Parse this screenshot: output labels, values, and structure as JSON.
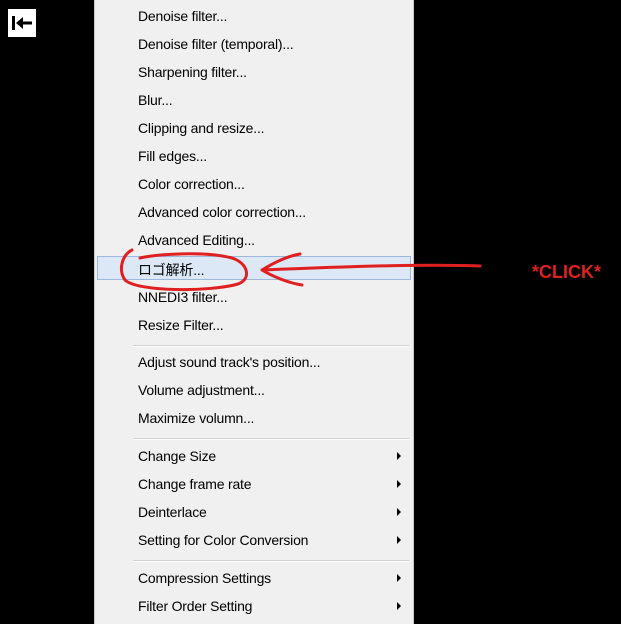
{
  "back_button": {
    "icon": "arrow-to-left-bar-icon"
  },
  "menu": {
    "groups": [
      {
        "items": [
          {
            "label": "Denoise filter...",
            "submenu": false
          },
          {
            "label": "Denoise filter (temporal)...",
            "submenu": false
          },
          {
            "label": "Sharpening filter...",
            "submenu": false
          },
          {
            "label": "Blur...",
            "submenu": false
          },
          {
            "label": "Clipping and resize...",
            "submenu": false
          },
          {
            "label": "Fill edges...",
            "submenu": false
          },
          {
            "label": "Color correction...",
            "submenu": false
          },
          {
            "label": "Advanced color correction...",
            "submenu": false
          },
          {
            "label": "Advanced Editing...",
            "submenu": false
          },
          {
            "label": "ロゴ解析...",
            "submenu": false,
            "highlighted": true
          },
          {
            "label": "NNEDI3 filter...",
            "submenu": false
          },
          {
            "label": "Resize Filter...",
            "submenu": false
          }
        ]
      },
      {
        "items": [
          {
            "label": "Adjust sound track's position...",
            "submenu": false
          },
          {
            "label": "Volume adjustment...",
            "submenu": false
          },
          {
            "label": "Maximize volumn...",
            "submenu": false
          }
        ]
      },
      {
        "items": [
          {
            "label": "Change Size",
            "submenu": true
          },
          {
            "label": "Change frame rate",
            "submenu": true
          },
          {
            "label": "Deinterlace",
            "submenu": true
          },
          {
            "label": "Setting for Color Conversion",
            "submenu": true
          }
        ]
      },
      {
        "items": [
          {
            "label": "Compression Settings",
            "submenu": true
          },
          {
            "label": "Filter Order Setting",
            "submenu": true
          }
        ]
      }
    ]
  },
  "annotation": {
    "text": "*CLICK*",
    "color": "#e02020"
  },
  "colors": {
    "background": "#000000",
    "menu_background": "#f0f0f0",
    "highlight": "#dce8f6",
    "highlight_border": "#9ab8dd"
  }
}
